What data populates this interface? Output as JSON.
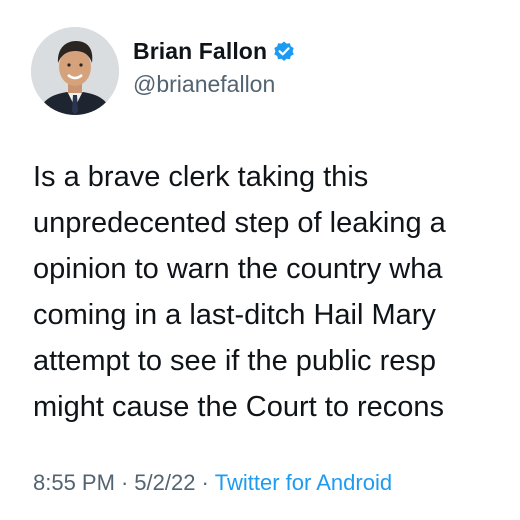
{
  "author": {
    "display_name": "Brian Fallon",
    "handle": "@brianefallon",
    "verified": true
  },
  "tweet": {
    "lines": [
      "Is a brave clerk taking this",
      "unpredecented step of leaking a",
      "opinion to warn the country wha",
      "coming in a last-ditch Hail Mary",
      "attempt to see if the public resp",
      "might cause the Court to recons"
    ]
  },
  "meta": {
    "time": "8:55 PM",
    "separator": "·",
    "date": "5/2/22",
    "source": "Twitter for Android"
  },
  "colors": {
    "text": "#0f1419",
    "secondary": "#536471",
    "accent": "#1d9bf0"
  },
  "icons": {
    "verified": "verified-badge-icon"
  }
}
